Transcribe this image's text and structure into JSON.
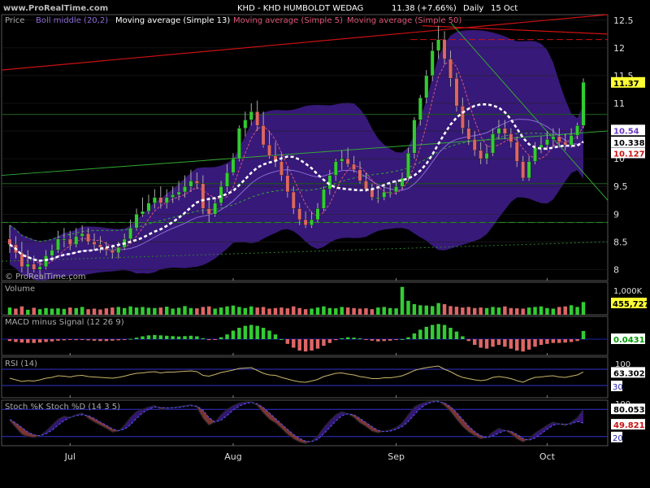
{
  "header": {
    "watermark": "www.ProRealTime.com",
    "title": "KHD - KHD HUMBOLDT WEDAG",
    "price": "11.38 (+7.66%)",
    "period": "Daily",
    "date": "15 Oct",
    "copyright": "© ProRealTime.com"
  },
  "legend": {
    "price": "Price",
    "boll": "Boll middle (20,2)",
    "ma13": "Moving average (Simple 13)",
    "ma5": "Moving average (Simple 5)",
    "ma50": "Moving average (Simple 50)"
  },
  "colors": {
    "up": "#33cc33",
    "down": "#dd6666",
    "band": "#3a1a80",
    "grid": "#1c4f1c",
    "ma13": "#ffffff",
    "ma5": "#dd5577",
    "ma50": "#33aa33",
    "trend_red": "#cc1111",
    "label_box": "#ffff33"
  },
  "chart_data": [
    {
      "type": "candlestick",
      "name": "price",
      "yticks": [
        "12.5",
        "12",
        "11.5",
        "11",
        "10.5",
        "10",
        "9.5",
        "9",
        "8.5",
        "8"
      ],
      "ylim": [
        7.8,
        12.6
      ],
      "x_labels": [
        "Jul",
        "Aug",
        "Sep",
        "Oct"
      ],
      "x_label_index": [
        10,
        37,
        64,
        89
      ],
      "value_labels": [
        "11.37",
        "10.54",
        "10.338",
        "10.127"
      ],
      "open": [
        8.55,
        8.45,
        8.3,
        8.05,
        8.1,
        8.0,
        8.05,
        8.25,
        8.35,
        8.55,
        8.55,
        8.45,
        8.6,
        8.65,
        8.5,
        8.45,
        8.4,
        8.35,
        8.3,
        8.4,
        8.55,
        8.75,
        9.0,
        9.05,
        9.2,
        9.3,
        9.2,
        9.3,
        9.35,
        9.4,
        9.5,
        9.6,
        9.55,
        9.1,
        9.0,
        9.2,
        9.5,
        9.75,
        10.0,
        10.55,
        10.7,
        10.85,
        10.6,
        10.25,
        10.05,
        9.95,
        9.7,
        9.4,
        9.1,
        8.9,
        8.8,
        8.9,
        9.1,
        9.45,
        9.7,
        9.95,
        10.0,
        9.9,
        9.8,
        9.6,
        9.45,
        9.3,
        9.3,
        9.4,
        9.4,
        9.5,
        9.65,
        10.1,
        10.7,
        11.1,
        11.5,
        11.95,
        12.15,
        11.8,
        11.45,
        10.95,
        10.55,
        10.35,
        10.15,
        10.0,
        10.1,
        10.45,
        10.55,
        10.45,
        10.3,
        9.95,
        9.65,
        9.95,
        10.2,
        10.25,
        10.35,
        10.4,
        10.3,
        10.25,
        10.42,
        10.6
      ],
      "high": [
        8.8,
        8.6,
        8.5,
        8.35,
        8.25,
        8.15,
        8.35,
        8.45,
        8.7,
        8.75,
        8.7,
        8.75,
        8.8,
        8.75,
        8.65,
        8.6,
        8.5,
        8.45,
        8.5,
        8.65,
        8.9,
        9.1,
        9.3,
        9.35,
        9.45,
        9.5,
        9.45,
        9.5,
        9.6,
        9.7,
        9.8,
        9.75,
        9.7,
        9.3,
        9.3,
        9.6,
        9.9,
        10.1,
        10.6,
        10.85,
        11.0,
        11.05,
        10.85,
        10.5,
        10.3,
        10.1,
        9.85,
        9.5,
        9.2,
        9.05,
        9.05,
        9.2,
        9.5,
        9.8,
        10.0,
        10.15,
        10.2,
        10.05,
        9.95,
        9.75,
        9.55,
        9.45,
        9.5,
        9.55,
        9.6,
        9.75,
        10.2,
        10.75,
        11.15,
        11.6,
        12.1,
        12.4,
        12.3,
        11.95,
        11.55,
        11.1,
        10.7,
        10.5,
        10.3,
        10.25,
        10.55,
        10.7,
        10.7,
        10.55,
        10.4,
        10.05,
        10.05,
        10.3,
        10.4,
        10.5,
        10.55,
        10.55,
        10.45,
        10.55,
        10.65,
        11.45
      ],
      "low": [
        8.3,
        8.2,
        7.95,
        7.9,
        7.95,
        7.85,
        8.0,
        8.15,
        8.3,
        8.4,
        8.35,
        8.4,
        8.5,
        8.45,
        8.35,
        8.3,
        8.25,
        8.2,
        8.2,
        8.35,
        8.5,
        8.7,
        8.95,
        9.0,
        9.1,
        9.1,
        9.1,
        9.2,
        9.25,
        9.3,
        9.4,
        9.45,
        9.0,
        8.85,
        8.95,
        9.15,
        9.4,
        9.7,
        9.95,
        10.4,
        10.6,
        10.5,
        10.2,
        10.0,
        9.85,
        9.6,
        9.3,
        9.0,
        8.8,
        8.75,
        8.75,
        8.85,
        9.05,
        9.35,
        9.6,
        9.8,
        9.85,
        9.75,
        9.55,
        9.4,
        9.25,
        9.2,
        9.25,
        9.3,
        9.35,
        9.45,
        9.6,
        10.0,
        10.6,
        11.0,
        11.4,
        11.8,
        11.7,
        11.3,
        10.85,
        10.45,
        10.25,
        10.05,
        9.9,
        9.9,
        10.05,
        10.35,
        10.35,
        10.2,
        9.85,
        9.6,
        9.6,
        9.9,
        10.1,
        10.15,
        10.2,
        10.2,
        10.15,
        10.2,
        10.35,
        10.55
      ],
      "close": [
        8.45,
        8.3,
        8.05,
        8.1,
        8.0,
        8.05,
        8.25,
        8.35,
        8.55,
        8.55,
        8.45,
        8.6,
        8.65,
        8.5,
        8.45,
        8.4,
        8.35,
        8.3,
        8.4,
        8.55,
        8.75,
        9.0,
        9.05,
        9.2,
        9.3,
        9.2,
        9.3,
        9.35,
        9.4,
        9.5,
        9.6,
        9.55,
        9.1,
        9.0,
        9.2,
        9.5,
        9.75,
        10.0,
        10.55,
        10.7,
        10.85,
        10.6,
        10.25,
        10.05,
        9.95,
        9.7,
        9.4,
        9.1,
        8.9,
        8.8,
        8.9,
        9.1,
        9.45,
        9.7,
        9.95,
        10.0,
        9.9,
        9.8,
        9.6,
        9.45,
        9.3,
        9.3,
        9.4,
        9.4,
        9.5,
        9.65,
        10.1,
        10.7,
        11.1,
        11.5,
        11.95,
        12.15,
        11.8,
        11.45,
        10.95,
        10.55,
        10.35,
        10.15,
        10.0,
        10.1,
        10.45,
        10.55,
        10.45,
        10.3,
        9.95,
        9.65,
        9.95,
        10.2,
        10.25,
        10.35,
        10.4,
        10.3,
        10.25,
        10.42,
        10.6,
        11.38
      ]
    },
    {
      "type": "bar",
      "name": "Volume",
      "yticks": [
        "1,000K"
      ],
      "ylim": [
        0,
        1050
      ],
      "value_labels": [
        "455,727"
      ],
      "values": [
        260,
        220,
        300,
        180,
        250,
        200,
        240,
        220,
        230,
        210,
        260,
        240,
        280,
        200,
        220,
        190,
        230,
        260,
        280,
        240,
        300,
        260,
        280,
        250,
        240,
        260,
        290,
        220,
        250,
        310,
        240,
        230,
        280,
        300,
        220,
        260,
        300,
        330,
        280,
        240,
        300,
        260,
        280,
        220,
        240,
        260,
        230,
        300,
        240,
        200,
        220,
        260,
        300,
        240,
        230,
        280,
        260,
        240,
        220,
        230,
        200,
        260,
        280,
        240,
        230,
        1000,
        500,
        380,
        340,
        330,
        310,
        420,
        380,
        310,
        290,
        260,
        280,
        240,
        260,
        240,
        280,
        260,
        300,
        240,
        230,
        220,
        260,
        280,
        300,
        240,
        220,
        280,
        300,
        340,
        280,
        456
      ]
    },
    {
      "type": "bar",
      "name": "MACD minus Signal (12 26 9)",
      "ylim": [
        -0.09,
        0.09
      ],
      "value_labels": [
        "0.0431"
      ],
      "values": [
        -0.01,
        -0.015,
        -0.018,
        -0.02,
        -0.02,
        -0.018,
        -0.015,
        -0.012,
        -0.008,
        -0.006,
        -0.004,
        -0.005,
        -0.004,
        -0.006,
        -0.008,
        -0.01,
        -0.01,
        -0.008,
        -0.006,
        -0.003,
        0.002,
        0.008,
        0.015,
        0.02,
        0.022,
        0.02,
        0.018,
        0.016,
        0.014,
        0.016,
        0.018,
        0.015,
        0.005,
        -0.005,
        -0.002,
        0.01,
        0.025,
        0.045,
        0.06,
        0.07,
        0.075,
        0.07,
        0.06,
        0.045,
        0.025,
        0.0,
        -0.025,
        -0.045,
        -0.06,
        -0.065,
        -0.06,
        -0.05,
        -0.035,
        -0.02,
        -0.005,
        0.005,
        0.01,
        0.008,
        0.004,
        -0.002,
        -0.008,
        -0.012,
        -0.01,
        -0.008,
        -0.004,
        0.0,
        0.01,
        0.03,
        0.05,
        0.065,
        0.075,
        0.08,
        0.075,
        0.06,
        0.04,
        0.015,
        -0.01,
        -0.03,
        -0.045,
        -0.05,
        -0.04,
        -0.03,
        -0.04,
        -0.05,
        -0.06,
        -0.065,
        -0.055,
        -0.04,
        -0.03,
        -0.025,
        -0.02,
        -0.02,
        -0.018,
        -0.015,
        -0.01,
        0.0431
      ]
    },
    {
      "type": "line",
      "name": "RSI (14)",
      "yticks": [
        "100",
        "30"
      ],
      "ylim": [
        0,
        100
      ],
      "bands": [
        70,
        30
      ],
      "value_labels": [
        "63.302",
        "30"
      ],
      "values": [
        48,
        44,
        40,
        42,
        41,
        44,
        48,
        50,
        54,
        53,
        51,
        54,
        55,
        52,
        51,
        50,
        49,
        48,
        50,
        53,
        57,
        60,
        61,
        63,
        64,
        61,
        63,
        63,
        64,
        65,
        66,
        64,
        55,
        53,
        57,
        62,
        65,
        68,
        72,
        73,
        74,
        67,
        60,
        56,
        55,
        50,
        46,
        42,
        39,
        38,
        41,
        45,
        52,
        56,
        60,
        61,
        58,
        56,
        52,
        50,
        47,
        47,
        49,
        49,
        51,
        54,
        60,
        67,
        71,
        74,
        76,
        78,
        70,
        64,
        56,
        50,
        47,
        44,
        42,
        44,
        50,
        52,
        50,
        47,
        42,
        38,
        45,
        50,
        51,
        53,
        54,
        51,
        50,
        53,
        56,
        63.3
      ]
    },
    {
      "type": "line",
      "name": "Stoch %K Stoch %D (14 3 5)",
      "yticks": [
        "100",
        "20"
      ],
      "ylim": [
        0,
        100
      ],
      "bands": [
        80,
        20
      ],
      "value_labels": [
        "80.053",
        "49.821",
        "20"
      ],
      "series": [
        {
          "name": "%K",
          "values": [
            55,
            40,
            25,
            20,
            18,
            22,
            32,
            45,
            58,
            65,
            62,
            68,
            72,
            60,
            52,
            45,
            38,
            30,
            32,
            45,
            62,
            75,
            80,
            85,
            88,
            80,
            82,
            84,
            86,
            88,
            90,
            84,
            60,
            45,
            52,
            68,
            80,
            88,
            94,
            96,
            97,
            88,
            72,
            58,
            50,
            38,
            25,
            15,
            8,
            5,
            10,
            22,
            40,
            55,
            68,
            75,
            70,
            62,
            50,
            42,
            32,
            28,
            32,
            35,
            40,
            50,
            68,
            85,
            92,
            96,
            98,
            98,
            88,
            75,
            58,
            42,
            30,
            22,
            15,
            18,
            30,
            38,
            34,
            26,
            15,
            8,
            15,
            28,
            36,
            45,
            52,
            48,
            44,
            52,
            62,
            80.05
          ]
        },
        {
          "name": "%D",
          "values": [
            58,
            50,
            40,
            30,
            24,
            22,
            26,
            34,
            45,
            55,
            62,
            66,
            68,
            66,
            60,
            52,
            45,
            37,
            33,
            36,
            46,
            60,
            72,
            80,
            85,
            84,
            83,
            83,
            84,
            86,
            88,
            87,
            78,
            62,
            52,
            56,
            66,
            78,
            87,
            92,
            95,
            92,
            84,
            72,
            60,
            48,
            36,
            25,
            16,
            10,
            9,
            14,
            26,
            40,
            54,
            66,
            70,
            68,
            60,
            51,
            42,
            34,
            31,
            32,
            36,
            42,
            53,
            68,
            82,
            91,
            96,
            97,
            94,
            86,
            73,
            58,
            43,
            31,
            22,
            18,
            21,
            28,
            33,
            32,
            25,
            16,
            12,
            17,
            26,
            36,
            45,
            48,
            47,
            48,
            53,
            49.82
          ]
        }
      ]
    }
  ]
}
